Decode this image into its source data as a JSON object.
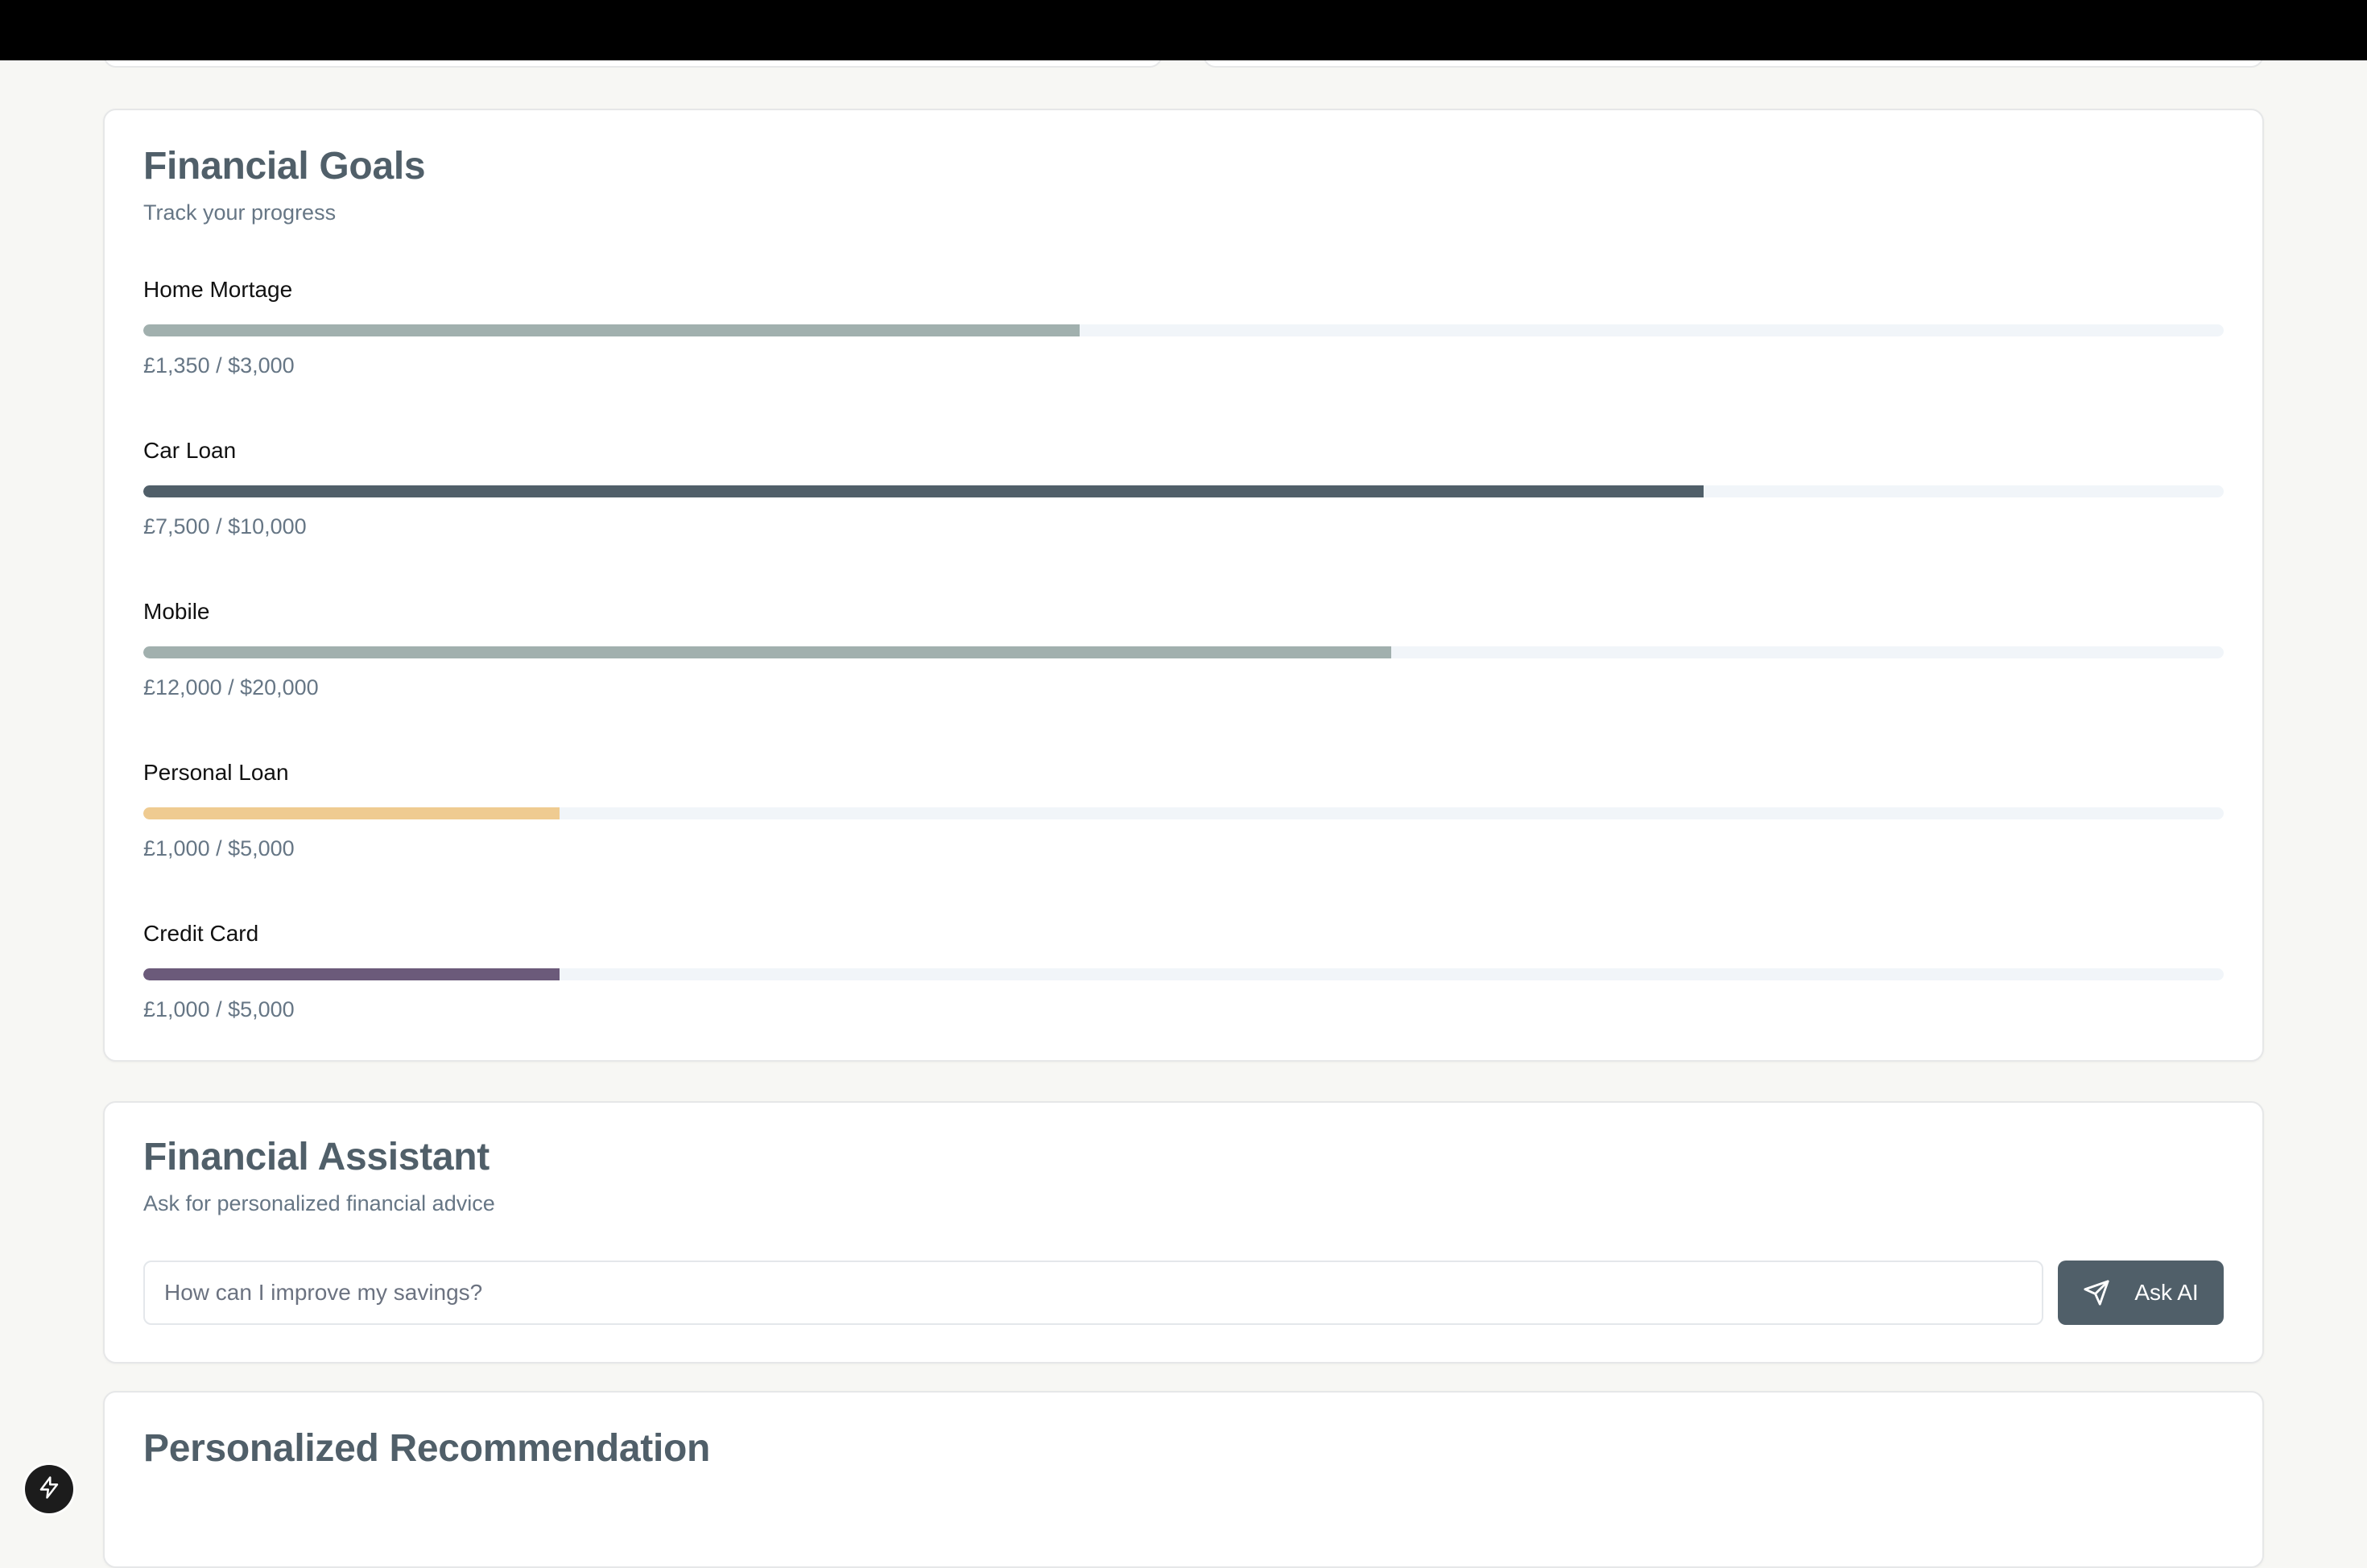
{
  "goals_card": {
    "title": "Financial Goals",
    "subtitle": "Track your progress",
    "goals": [
      {
        "name": "Home Mortage",
        "amount": "£1,350 / $3,000",
        "progress": 0.45,
        "color": "#a1b0ae"
      },
      {
        "name": "Car Loan",
        "amount": "£7,500 / $10,000",
        "progress": 0.75,
        "color": "#505f69"
      },
      {
        "name": "Mobile",
        "amount": "£12,000 / $20,000",
        "progress": 0.6,
        "color": "#a1b0ae"
      },
      {
        "name": "Personal Loan",
        "amount": "£1,000 / $5,000",
        "progress": 0.2,
        "color": "#efcb91"
      },
      {
        "name": "Credit Card",
        "amount": "£1,000 / $5,000",
        "progress": 0.2,
        "color": "#6b5a7a"
      }
    ]
  },
  "assistant_card": {
    "title": "Financial Assistant",
    "subtitle": "Ask for personalized financial advice",
    "input_placeholder": "How can I improve my savings?",
    "button_label": "Ask AI",
    "button_icon": "send-icon"
  },
  "recommendation_card": {
    "title": "Personalized Recommendation"
  },
  "fab": {
    "icon": "lightning-icon"
  },
  "colors": {
    "page_background": "#f7f7f4",
    "heading": "#505f69",
    "muted_text": "#667685",
    "track": "#f1f5f9",
    "button": "#505f69"
  }
}
